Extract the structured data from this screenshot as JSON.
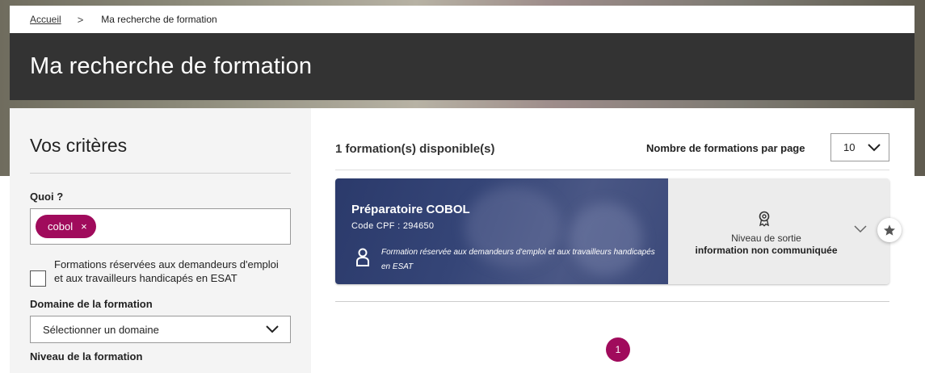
{
  "breadcrumb": {
    "home": "Accueil",
    "separator": ">",
    "current": "Ma recherche de formation"
  },
  "header": {
    "title": "Ma recherche de formation"
  },
  "criteria": {
    "title": "Vos critères",
    "quoi_label": "Quoi ?",
    "chip": {
      "label": "cobol",
      "remove": "×"
    },
    "checkbox_label": "Formations réservées aux demandeurs d'emploi et aux travailleurs handicapés en ESAT",
    "checkbox_checked": false,
    "domain_label": "Domaine de la formation",
    "domain_select": "Sélectionner un domaine",
    "niveau_label": "Niveau de la formation"
  },
  "results": {
    "count_text": "1 formation(s) disponible(s)",
    "per_page_label": "Nombre de formations par page",
    "per_page_value": "10",
    "cards": [
      {
        "title": "Préparatoire COBOL",
        "code": "Code CPF : 294650",
        "note": "Formation réservée aux demandeurs d'emploi et aux travailleurs handicapés en ESAT",
        "niveau_label": "Niveau de sortie",
        "niveau_value": "information non communiquée"
      }
    ],
    "pagination": {
      "current_page": "1"
    }
  },
  "colors": {
    "accent": "#a00b5c",
    "header_bg": "#333333",
    "card_bg": "#2f3e70"
  },
  "icons": [
    "chevron-right-icon",
    "close-icon",
    "chevron-down-icon",
    "person-icon",
    "award-icon",
    "star-icon"
  ]
}
